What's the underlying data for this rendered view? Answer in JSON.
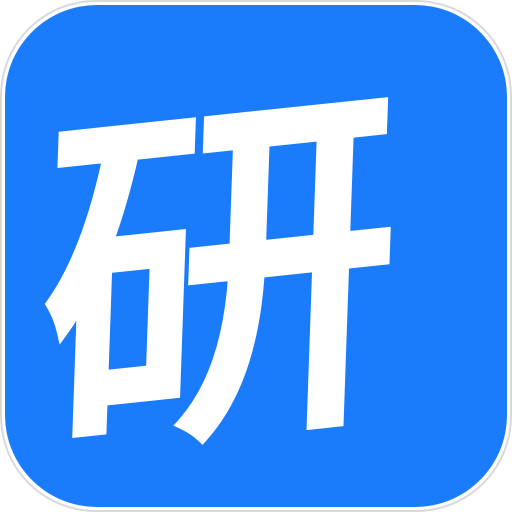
{
  "app_icon": {
    "glyph": "研",
    "background_color": "#1a7cfb",
    "glyph_color": "#ffffff",
    "border_color": "#d9d9d9"
  }
}
